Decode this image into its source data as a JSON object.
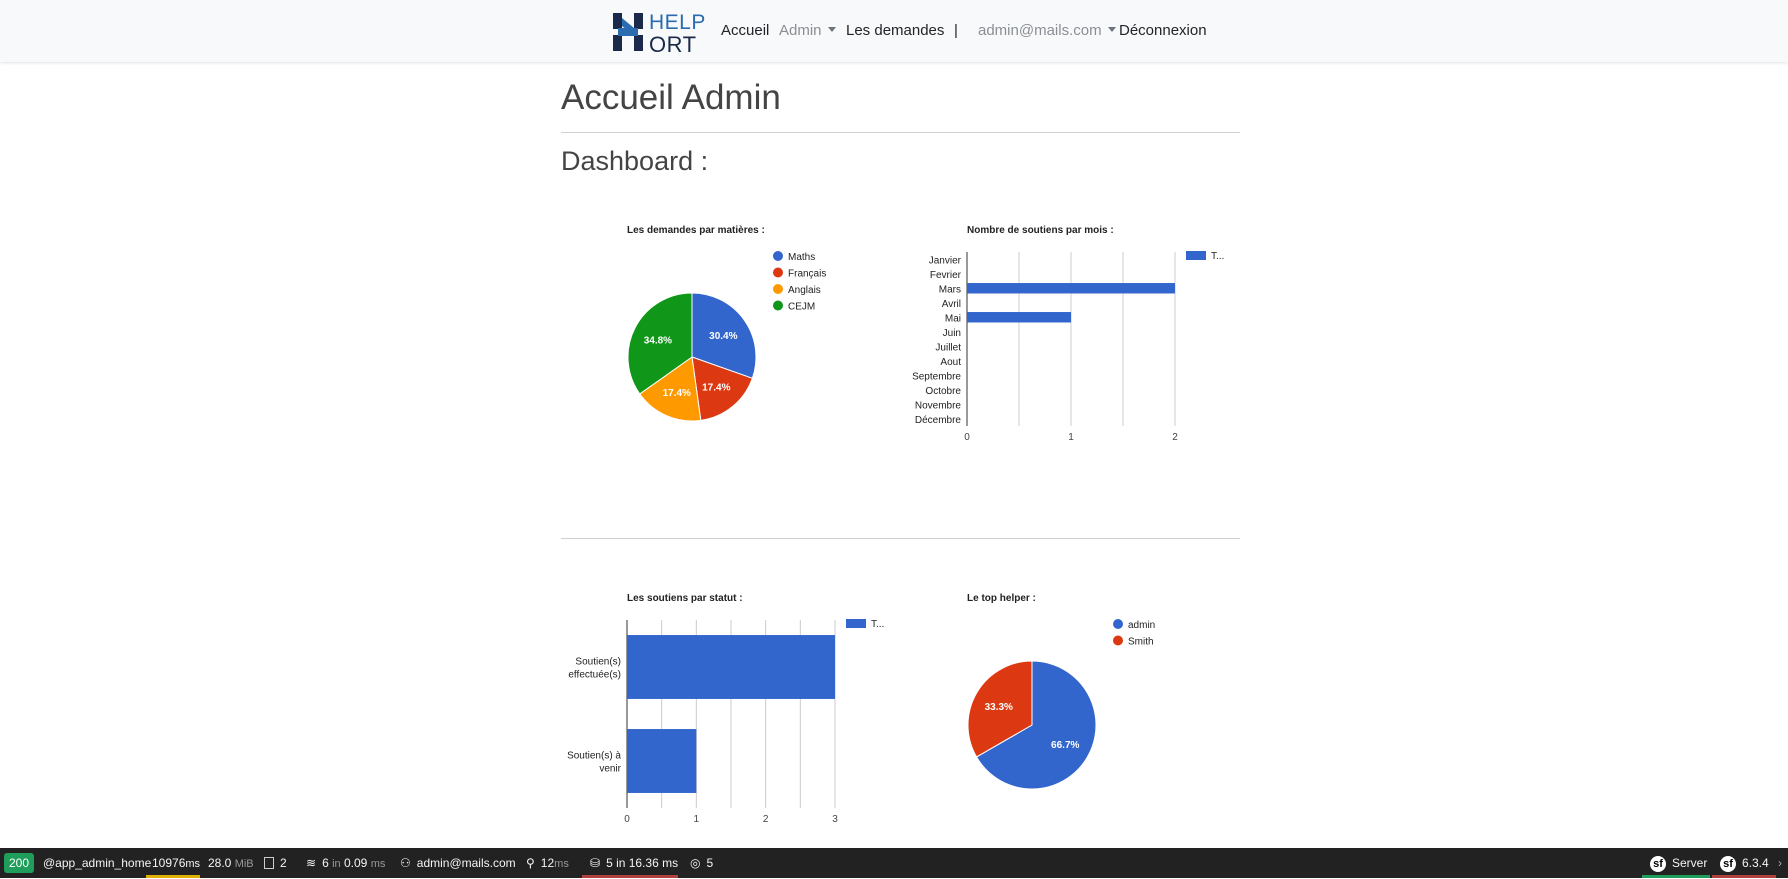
{
  "brand": {
    "help": "HELP",
    "ort": "ORT"
  },
  "nav": {
    "accueil": "Accueil",
    "admin": "Admin",
    "demandes": "Les demandes",
    "separator": "|",
    "user": "admin@mails.com",
    "logout": "Déconnexion"
  },
  "page": {
    "title": "Accueil Admin",
    "dashboard": "Dashboard :"
  },
  "colors": {
    "blue": "#3366cc",
    "red": "#dc3912",
    "orange": "#ff9900",
    "green": "#109618"
  },
  "chart_data": [
    {
      "type": "pie",
      "title": "Les demandes par matières :",
      "labels": [
        "Maths",
        "Français",
        "Anglais",
        "CEJM"
      ],
      "values": [
        30.4,
        17.4,
        17.4,
        34.8
      ],
      "slice_labels": [
        "30.4%",
        "17.4%",
        "17.4%",
        "34.8%"
      ],
      "legend": "right"
    },
    {
      "type": "bar",
      "orientation": "horizontal",
      "title": "Nombre de soutiens par mois :",
      "categories": [
        "Janvier",
        "Fevrier",
        "Mars",
        "Avril",
        "Mai",
        "Juin",
        "Juillet",
        "Aout",
        "Septembre",
        "Octobre",
        "Novembre",
        "Décembre"
      ],
      "values": [
        0,
        0,
        2,
        0,
        1,
        0,
        0,
        0,
        0,
        0,
        0,
        0
      ],
      "xlim": [
        0,
        2
      ],
      "ticks": [
        "0",
        "1",
        "2"
      ],
      "legend_label": "T...",
      "legend": "top-right"
    },
    {
      "type": "bar",
      "orientation": "horizontal",
      "title": "Les soutiens par statut :",
      "categories": [
        [
          "Soutien(s)",
          "effectuée(s)"
        ],
        [
          "Soutien(s) à",
          "venir"
        ]
      ],
      "values": [
        3,
        1
      ],
      "xlim": [
        0,
        3
      ],
      "ticks": [
        "0",
        "1",
        "2",
        "3"
      ],
      "legend_label": "T...",
      "legend": "top-right"
    },
    {
      "type": "pie",
      "title": "Le top helper :",
      "labels": [
        "admin",
        "Smith"
      ],
      "values": [
        66.7,
        33.3
      ],
      "slice_labels": [
        "66.7%",
        "33.3%"
      ],
      "legend": "right"
    }
  ],
  "debug": {
    "status": "200",
    "route": "@app_admin_home",
    "time": "10976",
    "time_unit": "ms",
    "memory": "28.0",
    "memory_unit": "MiB",
    "logs": "2",
    "templates": "6",
    "templates_in": "in",
    "templates_time": "0.09",
    "templates_unit": "ms",
    "user": "admin@mails.com",
    "events": "12",
    "events_unit": "ms",
    "db": "5 in 16.36 ms",
    "other": "5",
    "server": "Server",
    "version": "6.3.4"
  }
}
